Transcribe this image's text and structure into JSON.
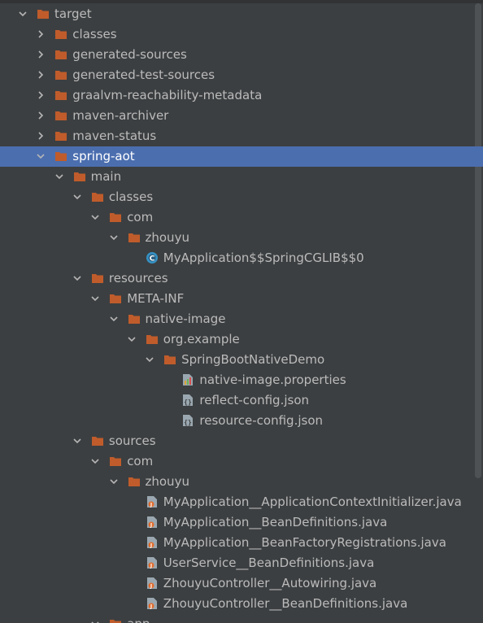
{
  "tree": {
    "items": [
      {
        "label": "target",
        "depth": 0,
        "expanded": true,
        "icon": "folder-icon"
      },
      {
        "label": "classes",
        "depth": 1,
        "expanded": false,
        "icon": "folder-icon"
      },
      {
        "label": "generated-sources",
        "depth": 1,
        "expanded": false,
        "icon": "folder-icon"
      },
      {
        "label": "generated-test-sources",
        "depth": 1,
        "expanded": false,
        "icon": "folder-icon"
      },
      {
        "label": "graalvm-reachability-metadata",
        "depth": 1,
        "expanded": false,
        "icon": "folder-icon"
      },
      {
        "label": "maven-archiver",
        "depth": 1,
        "expanded": false,
        "icon": "folder-icon"
      },
      {
        "label": "maven-status",
        "depth": 1,
        "expanded": false,
        "icon": "folder-icon"
      },
      {
        "label": "spring-aot",
        "depth": 1,
        "expanded": true,
        "icon": "folder-icon",
        "selected": true
      },
      {
        "label": "main",
        "depth": 2,
        "expanded": true,
        "icon": "folder-icon"
      },
      {
        "label": "classes",
        "depth": 3,
        "expanded": true,
        "icon": "folder-icon"
      },
      {
        "label": "com",
        "depth": 4,
        "expanded": true,
        "icon": "folder-icon"
      },
      {
        "label": "zhouyu",
        "depth": 5,
        "expanded": true,
        "icon": "folder-icon"
      },
      {
        "label": "MyApplication$$SpringCGLIB$$0",
        "depth": 6,
        "icon": "class-file-icon"
      },
      {
        "label": "resources",
        "depth": 3,
        "expanded": true,
        "icon": "folder-icon"
      },
      {
        "label": "META-INF",
        "depth": 4,
        "expanded": true,
        "icon": "folder-icon"
      },
      {
        "label": "native-image",
        "depth": 5,
        "expanded": true,
        "icon": "folder-icon"
      },
      {
        "label": "org.example",
        "depth": 6,
        "expanded": true,
        "icon": "folder-icon"
      },
      {
        "label": "SpringBootNativeDemo",
        "depth": 7,
        "expanded": true,
        "icon": "folder-icon"
      },
      {
        "label": "native-image.properties",
        "depth": 8,
        "icon": "properties-file-icon"
      },
      {
        "label": "reflect-config.json",
        "depth": 8,
        "icon": "json-file-icon"
      },
      {
        "label": "resource-config.json",
        "depth": 8,
        "icon": "json-file-icon"
      },
      {
        "label": "sources",
        "depth": 3,
        "expanded": true,
        "icon": "folder-icon"
      },
      {
        "label": "com",
        "depth": 4,
        "expanded": true,
        "icon": "folder-icon"
      },
      {
        "label": "zhouyu",
        "depth": 5,
        "expanded": true,
        "icon": "folder-icon"
      },
      {
        "label": "MyApplication__ApplicationContextInitializer.java",
        "depth": 6,
        "icon": "java-file-icon"
      },
      {
        "label": "MyApplication__BeanDefinitions.java",
        "depth": 6,
        "icon": "java-file-icon"
      },
      {
        "label": "MyApplication__BeanFactoryRegistrations.java",
        "depth": 6,
        "icon": "java-file-icon"
      },
      {
        "label": "UserService__BeanDefinitions.java",
        "depth": 6,
        "icon": "java-file-icon"
      },
      {
        "label": "ZhouyuController__Autowiring.java",
        "depth": 6,
        "icon": "java-file-icon"
      },
      {
        "label": "ZhouyuController__BeanDefinitions.java",
        "depth": 6,
        "icon": "java-file-icon"
      },
      {
        "label": "app",
        "depth": 4,
        "expanded": true,
        "icon": "folder-icon"
      }
    ]
  },
  "colors": {
    "background": "#3c3f41",
    "selection": "#4b6eaf",
    "folder": "#c05c2b",
    "text": "#bbbbbb"
  }
}
